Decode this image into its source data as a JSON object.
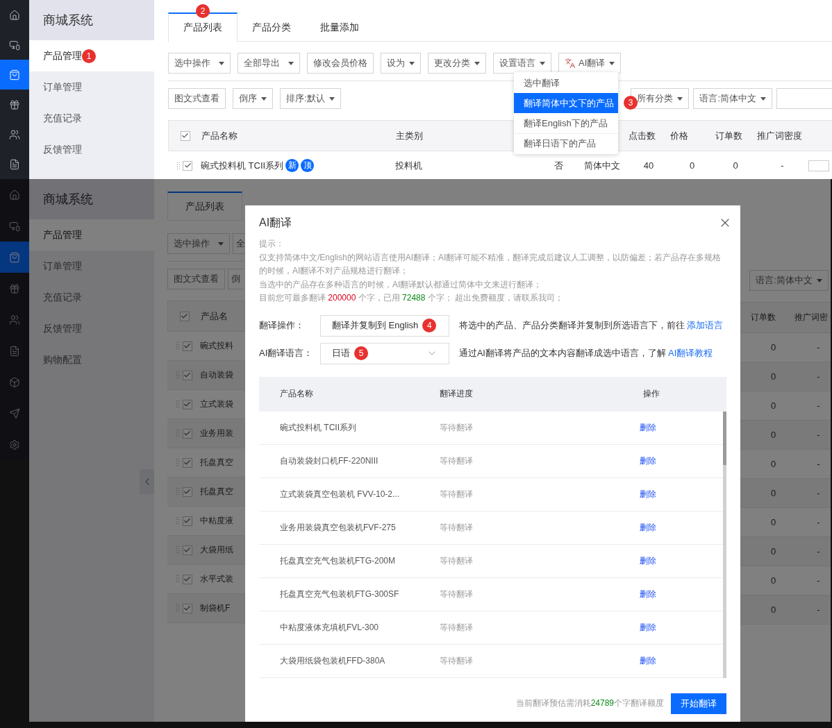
{
  "top_screen": {
    "rail": [
      {
        "kind": "home",
        "selected": false
      },
      {
        "kind": "devices",
        "selected": false
      },
      {
        "kind": "bag",
        "selected": true
      },
      {
        "kind": "gift",
        "selected": false
      },
      {
        "kind": "users",
        "selected": false
      },
      {
        "kind": "document",
        "selected": false
      }
    ],
    "nav": {
      "title": "商城系统",
      "items": [
        {
          "label": "产品管理",
          "selected": true,
          "badge": "1"
        },
        {
          "label": "订单管理",
          "selected": false
        },
        {
          "label": "充值记录",
          "selected": false
        },
        {
          "label": "反馈管理",
          "selected": false
        }
      ]
    },
    "tabs": [
      {
        "label": "产品列表",
        "selected": true,
        "badge": "2"
      },
      {
        "label": "产品分类",
        "selected": false
      },
      {
        "label": "批量添加",
        "selected": false
      }
    ],
    "toolbar": [
      {
        "label": "选中操作",
        "kind": "dropdown"
      },
      {
        "label": "全部导出",
        "kind": "dropdown"
      },
      {
        "label": "修改会员价格",
        "kind": "button"
      },
      {
        "label": "设为",
        "kind": "caret"
      },
      {
        "label": "更改分类",
        "kind": "caret"
      },
      {
        "label": "设置语言",
        "kind": "caret"
      },
      {
        "label": "AI翻译",
        "kind": "translate"
      }
    ],
    "menu": [
      {
        "label": "选中翻译",
        "selected": false
      },
      {
        "label": "翻译简体中文下的产品",
        "selected": true,
        "badge": "3"
      },
      {
        "label": "翻译English下的产品",
        "selected": false
      },
      {
        "label": "翻译日语下的产品",
        "selected": false
      }
    ],
    "filters_left": [
      {
        "label": "图文式查看",
        "kind": "button"
      },
      {
        "label": "倒序",
        "kind": "caret"
      },
      {
        "label": "排序:默认",
        "kind": "caret"
      }
    ],
    "filters_right": [
      {
        "label": "所有分类",
        "kind": "caret"
      },
      {
        "label": "语言:简体中文",
        "kind": "caret"
      }
    ],
    "table": {
      "header_checked": true,
      "columns": [
        "产品名称",
        "主类别",
        "",
        "",
        "点击数",
        "价格",
        "订单数",
        "推广词密度"
      ],
      "rows": [
        {
          "checked": true,
          "tags": [
            "新",
            "顶"
          ],
          "cells": [
            "碗式投料机 TCII系列",
            "投料机",
            "否",
            "简体中文",
            "40",
            "0",
            "0",
            "-"
          ]
        }
      ]
    }
  },
  "back_screen": {
    "rail": [
      {
        "kind": "home",
        "selected": false
      },
      {
        "kind": "devices",
        "selected": false
      },
      {
        "kind": "bag",
        "selected": true
      },
      {
        "kind": "gift",
        "selected": false
      },
      {
        "kind": "users",
        "selected": false
      },
      {
        "kind": "document",
        "selected": false
      },
      {
        "kind": "box",
        "selected": false
      },
      {
        "kind": "send",
        "selected": false
      },
      {
        "kind": "settings",
        "selected": false
      }
    ],
    "nav": {
      "title": "商城系统",
      "items": [
        {
          "label": "产品管理",
          "selected": true
        },
        {
          "label": "订单管理",
          "selected": false
        },
        {
          "label": "充值记录",
          "selected": false
        },
        {
          "label": "反馈管理",
          "selected": false
        },
        {
          "label": "购物配置",
          "selected": false
        }
      ]
    },
    "tab": {
      "label": "产品列表",
      "selected": true
    },
    "toolbar": [
      {
        "label": "选中操作",
        "kind": "dropdown"
      },
      {
        "label": "全",
        "kind": "cut"
      }
    ],
    "filters": [
      {
        "label": "图文式查看",
        "kind": "button"
      },
      {
        "label": "倒",
        "kind": "cut"
      }
    ],
    "right_filter": {
      "label": "语言:简体中文"
    },
    "header_checked": true,
    "name_column": "产品名",
    "right_columns": [
      "订单数",
      "推广词密"
    ],
    "rows": [
      {
        "checked": true,
        "name": "碗式投料",
        "orders": "0",
        "density": "-"
      },
      {
        "checked": true,
        "name": "自动装袋",
        "orders": "0",
        "density": "-"
      },
      {
        "checked": true,
        "name": "立式装袋",
        "orders": "0",
        "density": "-"
      },
      {
        "checked": true,
        "name": "业务用装",
        "orders": "0",
        "density": "-"
      },
      {
        "checked": true,
        "name": "托盘真空",
        "orders": "0",
        "density": "-"
      },
      {
        "checked": true,
        "name": "托盘真空",
        "orders": "0",
        "density": "-"
      },
      {
        "checked": true,
        "name": "中粘度液",
        "orders": "0",
        "density": "-"
      },
      {
        "checked": true,
        "name": "大袋用纸",
        "orders": "0",
        "density": "-"
      },
      {
        "checked": true,
        "name": "水平式装",
        "orders": "0",
        "density": "-"
      },
      {
        "checked": true,
        "name": "制袋机F",
        "orders": "0",
        "density": "-"
      }
    ]
  },
  "dialog": {
    "title": "AI翻译",
    "hint_title": "提示：",
    "hints": [
      "仅支持简体中文/English的网站语言使用AI翻译；AI翻译可能不精准，翻译完成后建议人工调整，以防偏差；若产品存在多规格的时候，AI翻译不对产品规格进行翻译；",
      "当选中的产品存在多种语言的时候，AI翻译默认都通过简体中文来进行翻译；"
    ],
    "quota": [
      {
        "kind": "plain",
        "text": "目前您可最多翻译 "
      },
      {
        "kind": "limit",
        "text": "200000"
      },
      {
        "kind": "plain",
        "text": " 个字，已用 "
      },
      {
        "kind": "used",
        "text": "72488"
      },
      {
        "kind": "plain",
        "text": " 个字； 超出免费额度，请联系我司；"
      }
    ],
    "fields": [
      {
        "label": "翻译操作：",
        "value": "翻译并复制到 English",
        "badge": "4",
        "note": "将选中的产品、产品分类翻译并复制到所选语言下，前往 ",
        "link": "添加语言"
      },
      {
        "label": "AI翻译语言：",
        "value": "日语",
        "badge": "5",
        "note": "通过AI翻译将产品的文本内容翻译成选中语言，了解 ",
        "link": "AI翻译教程"
      }
    ],
    "columns": [
      "产品名称",
      "翻译进度",
      "操作"
    ],
    "rows": [
      {
        "name": "碗式投料机 TCII系列",
        "status": "等待翻译",
        "action": "删除"
      },
      {
        "name": "自动装袋封口机FF-220NIII",
        "status": "等待翻译",
        "action": "删除"
      },
      {
        "name": "立式装袋真空包装机 FVV-10-2...",
        "status": "等待翻译",
        "action": "删除"
      },
      {
        "name": "业务用装袋真空包装机FVF-275",
        "status": "等待翻译",
        "action": "删除"
      },
      {
        "name": "托盘真空充气包装机FTG-200M",
        "status": "等待翻译",
        "action": "删除"
      },
      {
        "name": "托盘真空充气包装机FTG-300SF",
        "status": "等待翻译",
        "action": "删除"
      },
      {
        "name": "中粘度液体充填机FVL-300",
        "status": "等待翻译",
        "action": "删除"
      },
      {
        "name": "大袋用纸袋包装机FFD-380A",
        "status": "等待翻译",
        "action": "删除"
      }
    ],
    "footer": [
      {
        "kind": "plain",
        "text": "当前翻译预估需消耗"
      },
      {
        "kind": "used",
        "text": "24789"
      },
      {
        "kind": "plain",
        "text": "个字翻译额度"
      }
    ],
    "submit": "开始翻译"
  }
}
